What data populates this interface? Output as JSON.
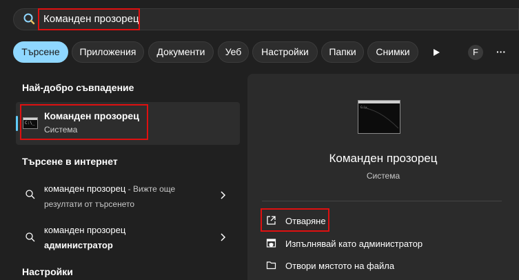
{
  "search": {
    "query": "Команден прозорец"
  },
  "tabs": [
    {
      "label": "Търсене",
      "active": true
    },
    {
      "label": "Приложения",
      "active": false
    },
    {
      "label": "Документи",
      "active": false
    },
    {
      "label": "Уеб",
      "active": false
    },
    {
      "label": "Настройки",
      "active": false
    },
    {
      "label": "Папки",
      "active": false
    },
    {
      "label": "Снимки",
      "active": false
    }
  ],
  "header_extras": {
    "avatar_letter": "F",
    "more_label": "···"
  },
  "best_match": {
    "section_title": "Най-добро съвпадение",
    "title": "Команден прозорец",
    "subtitle": "Система",
    "icon": "command-prompt-icon"
  },
  "web_search": {
    "section_title": "Търсене в интернет",
    "items": [
      {
        "query": "команден прозорец",
        "suffix": " - Вижте още",
        "line2": "резултати от търсенето"
      },
      {
        "query": "команден прозорец",
        "line2": "администратор"
      }
    ]
  },
  "settings_section": {
    "section_title": "Настройки"
  },
  "preview": {
    "title": "Команден прозорец",
    "subtitle": "Система",
    "actions": [
      {
        "label": "Отваряне",
        "icon": "open-external-icon"
      },
      {
        "label": "Изпълнявай като администратор",
        "icon": "shield-admin-icon"
      },
      {
        "label": "Отвори мястото на файла",
        "icon": "folder-icon"
      }
    ]
  },
  "colors": {
    "background": "#202020",
    "accent": "#60cdff",
    "active_tab": "#8fd7ff",
    "highlight_frame": "#e01010"
  }
}
